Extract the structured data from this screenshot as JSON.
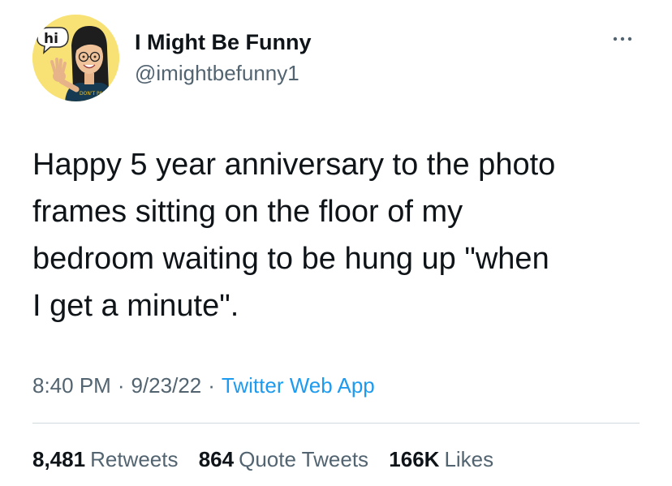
{
  "author": {
    "display_name": "I Might Be Funny",
    "handle": "@imightbefunny1",
    "avatar": {
      "bubble_text": "hi",
      "shirt_text": "DON'T PANIC",
      "background_color": "#f8e276"
    }
  },
  "tweet": {
    "text": "Happy 5 year anniversary to the photo\nframes sitting on the floor of my\nbedroom waiting to be hung up \"when\nI get a minute\"."
  },
  "meta": {
    "time": "8:40 PM",
    "separator": "·",
    "date": "9/23/22",
    "source": "Twitter Web App"
  },
  "stats": {
    "retweets": {
      "value": "8,481",
      "label": "Retweets"
    },
    "quote_tweets": {
      "value": "864",
      "label": "Quote Tweets"
    },
    "likes": {
      "value": "166K",
      "label": "Likes"
    }
  },
  "icons": {
    "more": "more-horizontal-icon"
  },
  "colors": {
    "text_primary": "#0f1419",
    "text_secondary": "#536471",
    "link_blue": "#1d9bf0",
    "divider": "#cfd9de"
  }
}
